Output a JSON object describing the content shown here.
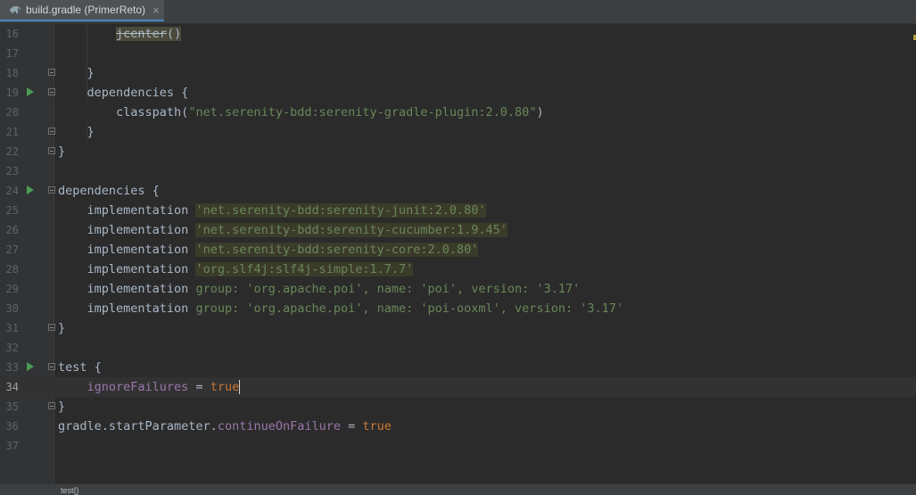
{
  "tab": {
    "title": "build.gradle (PrimerReto)",
    "close": "×",
    "icon": "gradle-elephant-icon"
  },
  "lines": [
    {
      "n": "16",
      "segs": [
        [
          "plain",
          "        "
        ],
        [
          "deprecated",
          "jcenter"
        ],
        [
          "paren",
          "()"
        ]
      ]
    },
    {
      "n": "17",
      "segs": []
    },
    {
      "n": "18",
      "segs": [
        [
          "plain",
          "    }"
        ]
      ],
      "fold": true
    },
    {
      "n": "19",
      "segs": [
        [
          "plain",
          "    dependencies {"
        ]
      ],
      "run": true,
      "fold": true
    },
    {
      "n": "20",
      "segs": [
        [
          "plain",
          "        classpath("
        ],
        [
          "str",
          "\"net.serenity-bdd:serenity-gradle-plugin:2.0.80\""
        ],
        [
          "plain",
          ")"
        ]
      ]
    },
    {
      "n": "21",
      "segs": [
        [
          "plain",
          "    }"
        ]
      ],
      "fold": true
    },
    {
      "n": "22",
      "segs": [
        [
          "plain",
          "}"
        ]
      ],
      "fold": true
    },
    {
      "n": "23",
      "segs": []
    },
    {
      "n": "24",
      "segs": [
        [
          "plain",
          "dependencies {"
        ]
      ],
      "run": true,
      "fold": true
    },
    {
      "n": "25",
      "segs": [
        [
          "plain",
          "    implementation "
        ],
        [
          "strhl",
          "'net.serenity-bdd:serenity-junit:2.0.80'"
        ]
      ]
    },
    {
      "n": "26",
      "segs": [
        [
          "plain",
          "    implementation "
        ],
        [
          "strhl",
          "'net.serenity-bdd:serenity-cucumber:1.9.45'"
        ]
      ]
    },
    {
      "n": "27",
      "segs": [
        [
          "plain",
          "    implementation "
        ],
        [
          "strhl",
          "'net.serenity-bdd:serenity-core:2.0.80'"
        ]
      ]
    },
    {
      "n": "28",
      "segs": [
        [
          "plain",
          "    implementation "
        ],
        [
          "strhl",
          "'org.slf4j:slf4j-simple:1.7.7'"
        ]
      ]
    },
    {
      "n": "29",
      "segs": [
        [
          "plain",
          "    implementation "
        ],
        [
          "str",
          "group: 'org.apache.poi', name: 'poi', version: '3.17'"
        ]
      ]
    },
    {
      "n": "30",
      "segs": [
        [
          "plain",
          "    implementation "
        ],
        [
          "str",
          "group: 'org.apache.poi', name: 'poi-ooxml', version: '3.17'"
        ]
      ]
    },
    {
      "n": "31",
      "segs": [
        [
          "plain",
          "}"
        ]
      ],
      "fold": true
    },
    {
      "n": "32",
      "segs": []
    },
    {
      "n": "33",
      "segs": [
        [
          "plain",
          "test {"
        ]
      ],
      "run": true,
      "fold": true
    },
    {
      "n": "34",
      "segs": [
        [
          "plain",
          "    "
        ],
        [
          "prop",
          "ignoreFailures"
        ],
        [
          "plain",
          " = "
        ],
        [
          "kw",
          "true"
        ],
        [
          "cursor",
          ""
        ]
      ],
      "current": true
    },
    {
      "n": "35",
      "segs": [
        [
          "plain",
          "}"
        ]
      ],
      "fold": true
    },
    {
      "n": "36",
      "segs": [
        [
          "plain",
          "gradle.startParameter."
        ],
        [
          "prop",
          "continueOnFailure"
        ],
        [
          "plain",
          " = "
        ],
        [
          "kw",
          "true"
        ]
      ]
    },
    {
      "n": "37",
      "segs": []
    }
  ],
  "breadcrumb": "test{}",
  "colors": {
    "keyword": "#cc7832",
    "string": "#6a8759",
    "property": "#9876aa",
    "text": "#a9b7c6",
    "run": "#499c54"
  }
}
